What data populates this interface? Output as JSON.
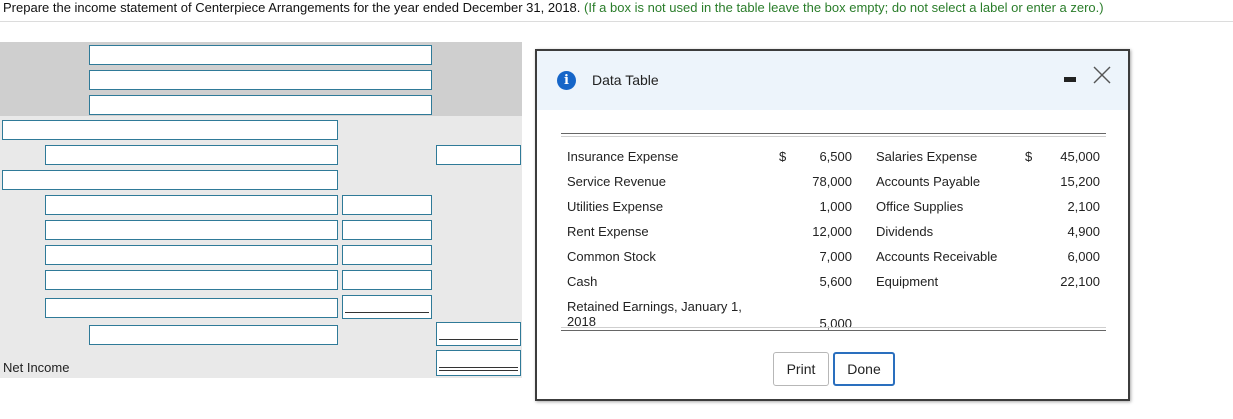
{
  "instruction": {
    "text": "Prepare the income statement of Centerpiece Arrangements for the year ended December 31, 2018.",
    "hint": "(If a box is not used in the table leave the box empty; do not select a label or enter a zero.)"
  },
  "worksheet": {
    "net_income_label": "Net Income"
  },
  "modal": {
    "title": "Data Table",
    "info_icon": "info-icon",
    "rows": [
      {
        "label1": "Insurance Expense",
        "dollar1": "$",
        "value1": "6,500",
        "label2": "Salaries Expense",
        "dollar2": "$",
        "value2": "45,000"
      },
      {
        "label1": "Service Revenue",
        "dollar1": "",
        "value1": "78,000",
        "label2": "Accounts Payable",
        "dollar2": "",
        "value2": "15,200"
      },
      {
        "label1": "Utilities Expense",
        "dollar1": "",
        "value1": "1,000",
        "label2": "Office Supplies",
        "dollar2": "",
        "value2": "2,100"
      },
      {
        "label1": "Rent Expense",
        "dollar1": "",
        "value1": "12,000",
        "label2": "Dividends",
        "dollar2": "",
        "value2": "4,900"
      },
      {
        "label1": "Common Stock",
        "dollar1": "",
        "value1": "7,000",
        "label2": "Accounts Receivable",
        "dollar2": "",
        "value2": "6,000"
      },
      {
        "label1": "Cash",
        "dollar1": "",
        "value1": "5,600",
        "label2": "Equipment",
        "dollar2": "",
        "value2": "22,100"
      },
      {
        "label1": "Retained Earnings, January 1, 2018",
        "dollar1": "",
        "value1": "5,000",
        "label2": "",
        "dollar2": "",
        "value2": ""
      }
    ],
    "print_label": "Print",
    "done_label": "Done"
  }
}
